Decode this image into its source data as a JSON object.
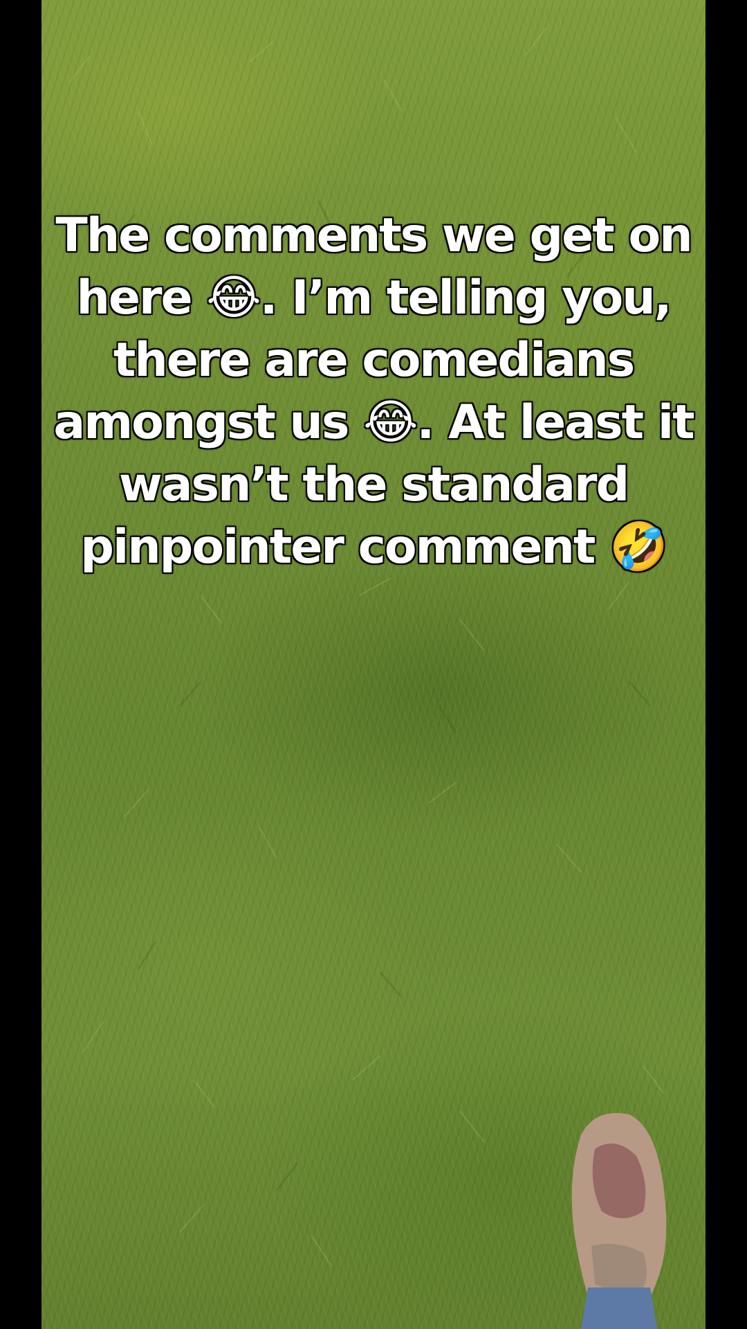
{
  "caption": {
    "lines": [
      "The comments we get on",
      "here 😂. I’m telling you,",
      "there are comedians",
      "amongst us 😂. At least it",
      "wasn’t the standard",
      "pinpointer comment 🤣"
    ]
  },
  "colors": {
    "letterbox": "#000000",
    "grass": "#6f8d34",
    "caption_text": "#ffffff"
  }
}
